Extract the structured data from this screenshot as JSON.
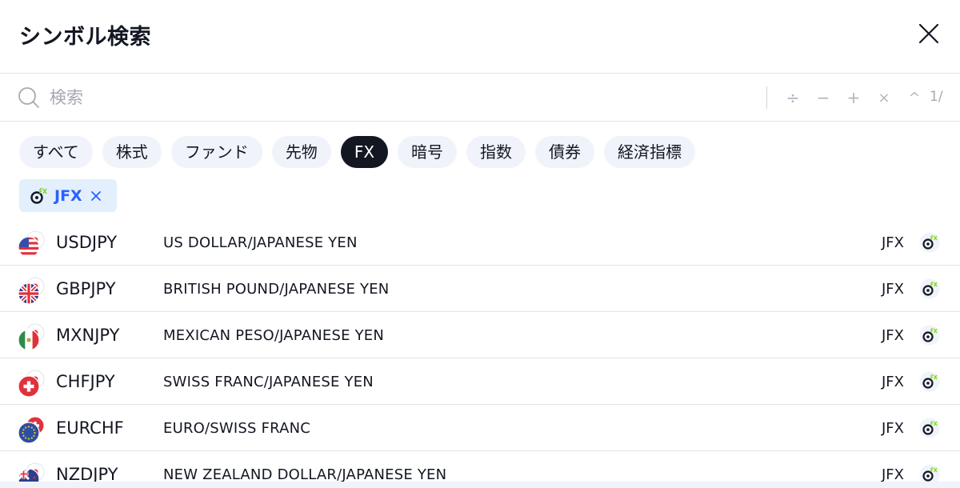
{
  "dialog": {
    "title": "シンボル検索"
  },
  "search": {
    "placeholder": "検索",
    "value": "",
    "ops": [
      "÷",
      "−",
      "+",
      "×",
      "^"
    ],
    "page_indicator": "1/"
  },
  "tabs": [
    {
      "label": "すべて",
      "active": false
    },
    {
      "label": "株式",
      "active": false
    },
    {
      "label": "ファンド",
      "active": false
    },
    {
      "label": "先物",
      "active": false
    },
    {
      "label": "FX",
      "active": true
    },
    {
      "label": "暗号",
      "active": false
    },
    {
      "label": "指数",
      "active": false
    },
    {
      "label": "債券",
      "active": false
    },
    {
      "label": "経済指標",
      "active": false
    }
  ],
  "filter": {
    "label": "JFX"
  },
  "results": [
    {
      "symbol": "USDJPY",
      "description": "US DOLLAR/JAPANESE YEN",
      "exchange": "JFX",
      "flag": "us-jp-flag-icon"
    },
    {
      "symbol": "GBPJPY",
      "description": "BRITISH POUND/JAPANESE YEN",
      "exchange": "JFX",
      "flag": "gb-jp-flag-icon"
    },
    {
      "symbol": "MXNJPY",
      "description": "MEXICAN PESO/JAPANESE YEN",
      "exchange": "JFX",
      "flag": "mx-jp-flag-icon"
    },
    {
      "symbol": "CHFJPY",
      "description": "SWISS FRANC/JAPANESE YEN",
      "exchange": "JFX",
      "flag": "ch-jp-flag-icon"
    },
    {
      "symbol": "EURCHF",
      "description": "EURO/SWISS FRANC",
      "exchange": "JFX",
      "flag": "eu-ch-flag-icon"
    },
    {
      "symbol": "NZDJPY",
      "description": "NEW ZEALAND DOLLAR/JAPANESE YEN",
      "exchange": "JFX",
      "flag": "nz-jp-flag-icon"
    }
  ],
  "colors": {
    "accent": "#2962ff",
    "chip_bg": "#f0f3fa",
    "chip_active_bg": "#131722",
    "filter_bg": "#e3effd",
    "logo_green": "#7ed321"
  }
}
